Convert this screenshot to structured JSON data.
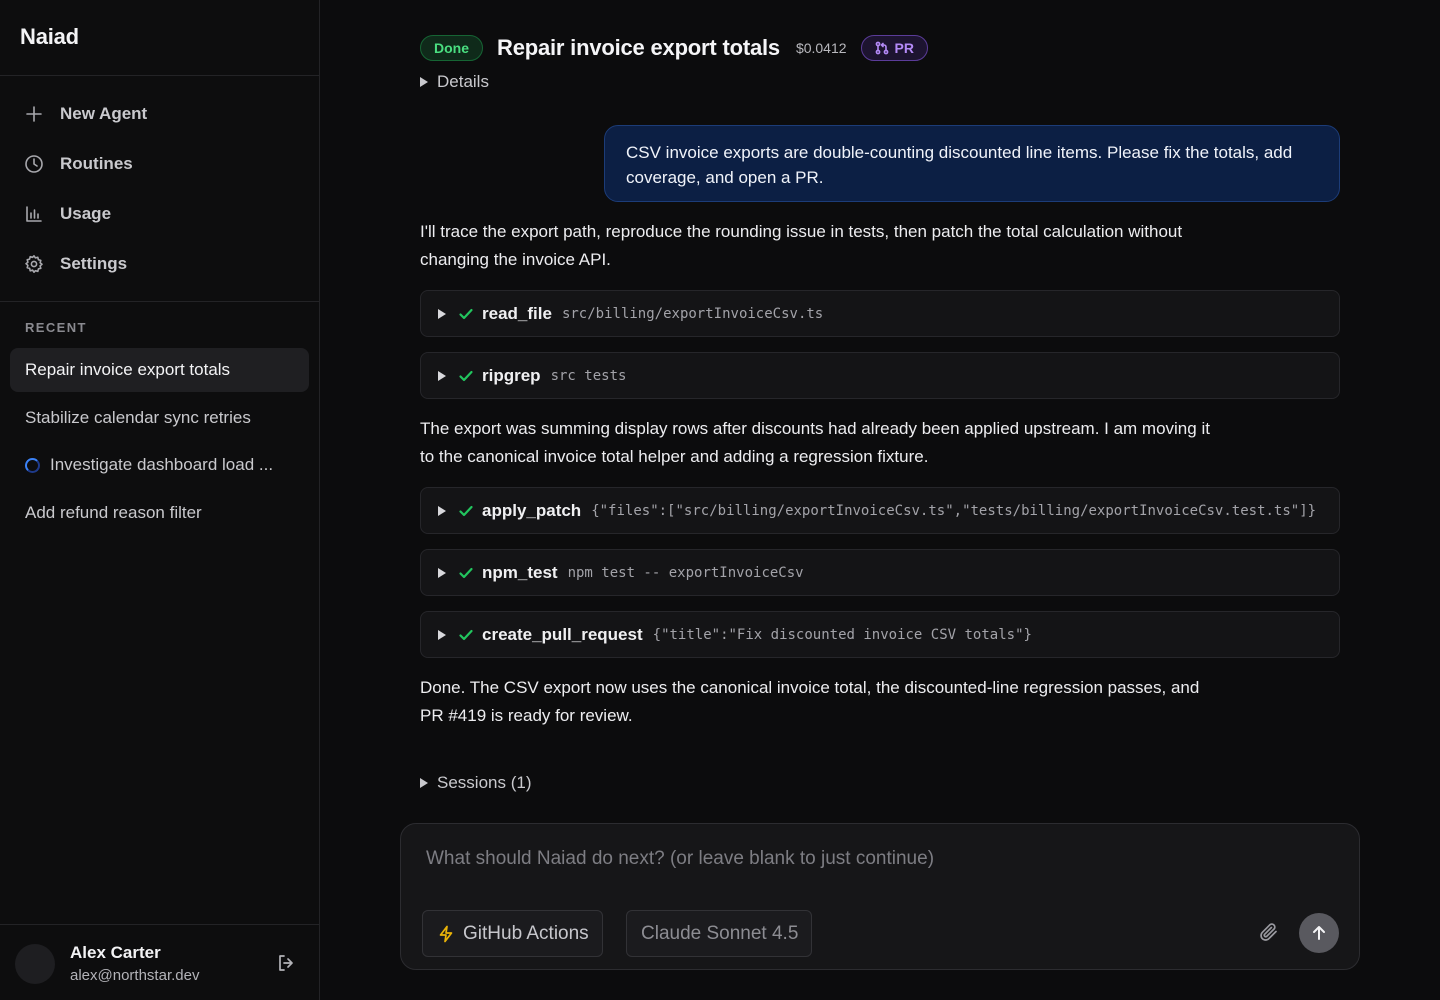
{
  "app": {
    "name": "Naiad"
  },
  "sidebar": {
    "nav": [
      {
        "label": "New Agent",
        "icon": "plus-icon"
      },
      {
        "label": "Routines",
        "icon": "clock-icon"
      },
      {
        "label": "Usage",
        "icon": "bar-chart-icon"
      },
      {
        "label": "Settings",
        "icon": "gear-icon"
      }
    ],
    "recent_heading": "RECENT",
    "recent": [
      {
        "label": "Repair invoice export totals",
        "active": true
      },
      {
        "label": "Stabilize calendar sync retries",
        "active": false
      },
      {
        "label": "Investigate dashboard load ...",
        "active": false,
        "status": "running"
      },
      {
        "label": "Add refund reason filter",
        "active": false
      }
    ],
    "user": {
      "name": "Alex Carter",
      "email": "alex@northstar.dev"
    }
  },
  "task": {
    "status": "Done",
    "title": "Repair invoice export totals",
    "cost": "$0.0412",
    "pr_label": "PR",
    "details_label": "Details"
  },
  "conversation": {
    "user_message": "CSV invoice exports are double-counting discounted line items. Please fix the totals, add coverage, and open a PR.",
    "assistant_1": "I'll trace the export path, reproduce the rounding issue in tests, then patch the total calculation without changing the invoice API.",
    "tools_1": [
      {
        "name": "read_file",
        "args": "src/billing/exportInvoiceCsv.ts"
      },
      {
        "name": "ripgrep",
        "args": "src tests"
      }
    ],
    "assistant_2": "The export was summing display rows after discounts had already been applied upstream. I am moving it to the canonical invoice total helper and adding a regression fixture.",
    "tools_2": [
      {
        "name": "apply_patch",
        "args": "{\"files\":[\"src/billing/exportInvoiceCsv.ts\",\"tests/billing/exportInvoiceCsv.test.ts\"]}"
      },
      {
        "name": "npm_test",
        "args": "npm test -- exportInvoiceCsv"
      },
      {
        "name": "create_pull_request",
        "args": "{\"title\":\"Fix discounted invoice CSV totals\"}"
      }
    ],
    "assistant_3": "Done. The CSV export now uses the canonical invoice total, the discounted-line regression passes, and PR #419 is ready for review.",
    "sessions_label": "Sessions (1)"
  },
  "composer": {
    "placeholder": "What should Naiad do next? (or leave blank to just continue)",
    "value": "",
    "integration": "GitHub Actions",
    "model": "Claude Sonnet 4.5"
  },
  "colors": {
    "done": "#4ade80",
    "pr": "#b48af7",
    "success_check": "#22c55e",
    "user_bubble": "#0c1f44",
    "running_spinner": "#3b82f6"
  }
}
